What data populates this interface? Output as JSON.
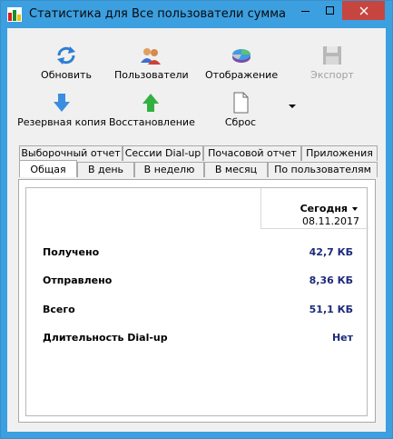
{
  "window": {
    "title": "Статистика для Все пользователи сумма"
  },
  "toolbar": {
    "refresh": "Обновить",
    "users": "Пользователи",
    "display": "Отображение",
    "export": "Экспорт",
    "backup": "Резервная копия",
    "restore": "Восстановление",
    "reset": "Сброс"
  },
  "tabs": {
    "top": [
      "Выборочный отчет",
      "Сессии Dial-up",
      "Почасовой отчет",
      "Приложения"
    ],
    "bottom": [
      "Общая",
      "В день",
      "В неделю",
      "В месяц",
      "По пользователям"
    ]
  },
  "table": {
    "column_title": "Сегодня",
    "column_date": "08.11.2017",
    "rows": [
      {
        "label": "Получено",
        "value": "42,7 КБ"
      },
      {
        "label": "Отправлено",
        "value": "8,36 КБ"
      },
      {
        "label": "Всего",
        "value": "51,1 КБ"
      },
      {
        "label": "Длительность Dial-up",
        "value": "Нет"
      }
    ]
  },
  "icons": {
    "app": "statistics-bar-icon",
    "refresh": "refresh-arrows-icon",
    "users": "users-icon",
    "display": "pie-chart-icon",
    "export": "floppy-disk-icon",
    "backup": "down-arrow-icon",
    "restore": "up-arrow-icon",
    "reset": "document-icon"
  },
  "colors": {
    "titlebar": "#3c9fe0",
    "close": "#c7453f",
    "value_text": "#1c2a7a"
  }
}
